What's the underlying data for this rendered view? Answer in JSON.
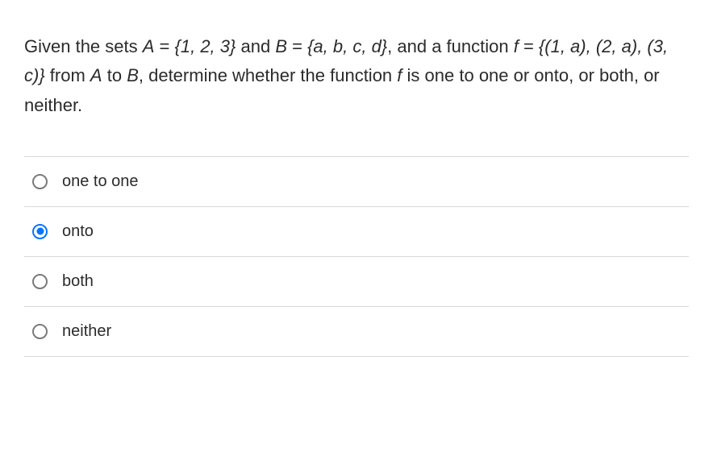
{
  "question": {
    "part1": "Given the sets ",
    "setA_label": "A",
    "eq1": " = ",
    "setA_value": "{1, 2, 3}",
    "and1": " and ",
    "setB_label": "B",
    "eq2": " = ",
    "setB_value": "{a, b, c, d}",
    "part2": ", and a function ",
    "f_label": "f",
    "eq3": " = ",
    "f_value": "{(1, a), (2, a), (3, c)}",
    "part3": " from ",
    "A2": "A",
    "to": " to ",
    "B2": "B",
    "part4": ", determine whether the function ",
    "f2": "f",
    "part5": " is one to one or onto, or both, or neither."
  },
  "options": [
    {
      "label": "one to one",
      "selected": false
    },
    {
      "label": "onto",
      "selected": true
    },
    {
      "label": "both",
      "selected": false
    },
    {
      "label": "neither",
      "selected": false
    }
  ]
}
